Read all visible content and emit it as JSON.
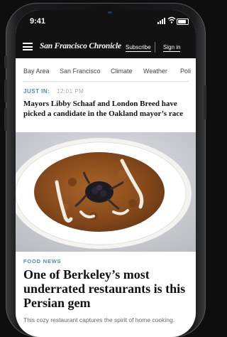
{
  "status_bar": {
    "time": "9:41"
  },
  "header": {
    "logo": "San Francisco Chronicle",
    "subscribe_label": "Subscribe",
    "signin_label": "Sign in"
  },
  "sections": [
    "Bay Area",
    "San Francisco",
    "Climate",
    "Weather",
    "Poli"
  ],
  "just_in": {
    "label": "JUST IN:",
    "time": "12:01 PM",
    "headline": "Mayors Libby Schaaf and London Breed have picked a candidate in the Oakland mayor’s race"
  },
  "feature": {
    "category": "FOOD NEWS",
    "headline": "One of Berkeley’s most underrated restaurants is this Persian gem",
    "dek": "This cozy restaurant captures the spirit of home cooking."
  },
  "colors": {
    "accent": "#4d8fa5",
    "topbar": "#121212"
  }
}
